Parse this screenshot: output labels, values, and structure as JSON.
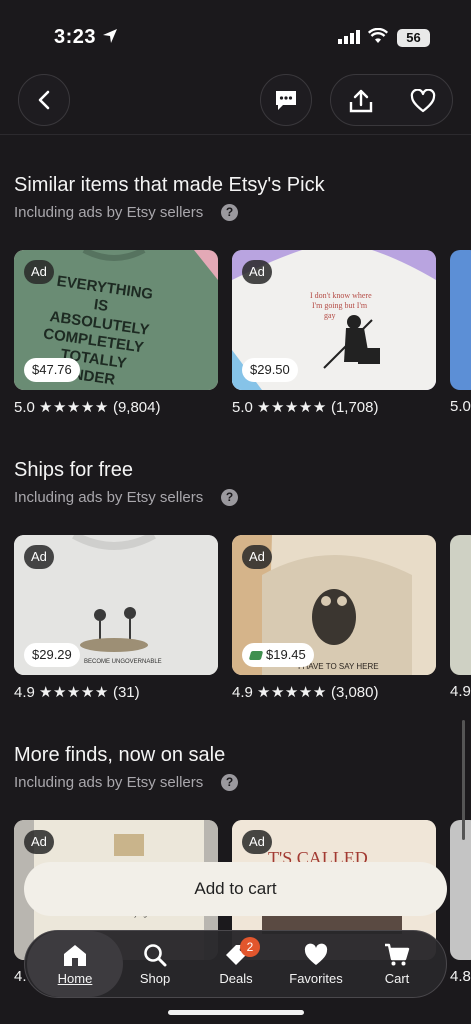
{
  "status_bar": {
    "time": "3:23",
    "battery": "56"
  },
  "sections": [
    {
      "title": "Similar items that made Etsy's Pick",
      "subtitle": "Including ads by Etsy sellers",
      "items": [
        {
          "ad_label": "Ad",
          "price": "$47.76",
          "sale": false,
          "rating": "5.0",
          "stars": "★★★★★",
          "reviews": "(9,804)",
          "image_text": "EVERYTHING IS ABSOLUTELY COMPLETELY TOTALLY UNDER"
        },
        {
          "ad_label": "Ad",
          "price": "$29.50",
          "sale": false,
          "rating": "5.0",
          "stars": "★★★★★",
          "reviews": "(1,708)",
          "image_text": "I don't know where I'm going but I'm gay"
        }
      ],
      "peek_rating": "5.0"
    },
    {
      "title": "Ships for free",
      "subtitle": "Including ads by Etsy sellers",
      "items": [
        {
          "ad_label": "Ad",
          "price": "$29.29",
          "sale": false,
          "rating": "4.9",
          "stars": "★★★★★",
          "reviews": "(31)",
          "image_text": "BECOME UNGOVERNABLE"
        },
        {
          "ad_label": "Ad",
          "price": "$19.45",
          "sale": true,
          "rating": "4.9",
          "stars": "★★★★★",
          "reviews": "(3,080)",
          "image_text": "I HAVE TO SAY HERE"
        }
      ],
      "peek_rating": "4.9"
    },
    {
      "title": "More finds, now on sale",
      "subtitle": "Including ads by Etsy sellers",
      "items": [
        {
          "ad_label": "Ad",
          "price": "",
          "sale": true,
          "rating": "4.",
          "stars": "",
          "reviews": "",
          "image_text": ""
        },
        {
          "ad_label": "Ad",
          "price": "",
          "sale": false,
          "rating": "",
          "stars": "",
          "reviews": "",
          "image_text": "T'S CALLED"
        }
      ],
      "peek_rating": "4.8"
    }
  ],
  "add_to_cart": "Add to cart",
  "tabs": [
    {
      "label": "Home",
      "icon": "home-icon",
      "active": true
    },
    {
      "label": "Shop",
      "icon": "search-icon",
      "active": false
    },
    {
      "label": "Deals",
      "icon": "tag-icon",
      "active": false,
      "badge": "2"
    },
    {
      "label": "Favorites",
      "icon": "heart-icon",
      "active": false
    },
    {
      "label": "Cart",
      "icon": "cart-icon",
      "active": false
    }
  ],
  "colors": {
    "background": "#1b191c",
    "sale_green": "#3f8f4f",
    "badge": "#e2562d",
    "button": "#f2efe8"
  }
}
